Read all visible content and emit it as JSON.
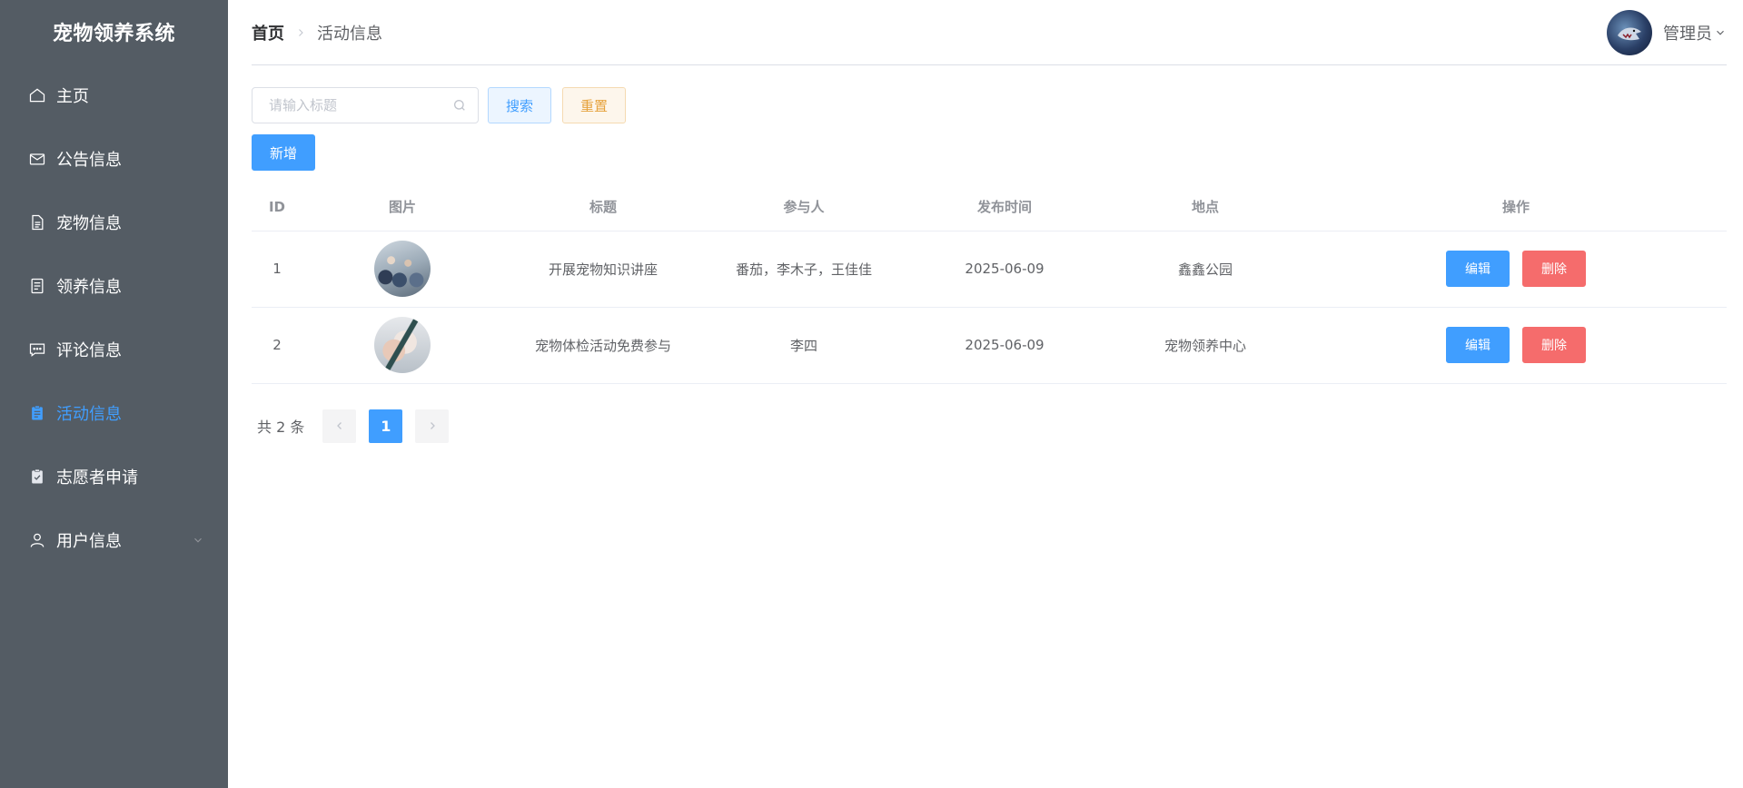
{
  "app": {
    "title": "宠物领养系统"
  },
  "sidebar": {
    "items": [
      {
        "label": "主页",
        "icon": "home-icon",
        "active": false
      },
      {
        "label": "公告信息",
        "icon": "mail-icon",
        "active": false
      },
      {
        "label": "宠物信息",
        "icon": "document-icon",
        "active": false
      },
      {
        "label": "领养信息",
        "icon": "document-list-icon",
        "active": false
      },
      {
        "label": "评论信息",
        "icon": "chat-dots-icon",
        "active": false
      },
      {
        "label": "活动信息",
        "icon": "clipboard-icon",
        "active": true
      },
      {
        "label": "志愿者申请",
        "icon": "checklist-icon",
        "active": false
      },
      {
        "label": "用户信息",
        "icon": "user-icon",
        "active": false,
        "has_submenu": true
      }
    ]
  },
  "header": {
    "breadcrumb": {
      "home": "首页",
      "current": "活动信息"
    },
    "user": {
      "name": "管理员"
    }
  },
  "toolbar": {
    "search_placeholder": "请输入标题",
    "search_value": "",
    "search_label": "搜索",
    "reset_label": "重置",
    "add_label": "新增"
  },
  "table": {
    "columns": [
      "ID",
      "图片",
      "标题",
      "参与人",
      "发布时间",
      "地点",
      "操作"
    ],
    "rows": [
      {
        "id": "1",
        "title": "开展宠物知识讲座",
        "participants": "番茄，李木子，王佳佳",
        "date": "2025-06-09",
        "location": "鑫鑫公园"
      },
      {
        "id": "2",
        "title": "宠物体检活动免费参与",
        "participants": "李四",
        "date": "2025-06-09",
        "location": "宠物领养中心"
      }
    ],
    "edit_label": "编辑",
    "delete_label": "删除"
  },
  "pagination": {
    "total_text": "共 2 条",
    "current_page": "1"
  },
  "colors": {
    "sidebar_bg": "#545c64",
    "primary": "#409eff",
    "danger": "#f56c6c",
    "warning": "#e6a23c"
  }
}
